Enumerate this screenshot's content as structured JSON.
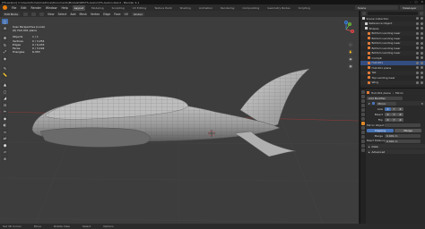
{
  "window": {
    "title": "[TS-Avalon] C:\\Users\\Home\\OneDrive\\Documents\\Models\\WIP\\TS-Avalon\\TS-Avalon.blend - Blender 4.1",
    "min": "–",
    "max": "□",
    "close": "✕"
  },
  "menubar": {
    "menus": [
      "File",
      "Edit",
      "Render",
      "Window",
      "Help"
    ],
    "tabs": [
      "Layout",
      "Modeling",
      "Sculpting",
      "UV Editing",
      "Texture Paint",
      "Shading",
      "Animation",
      "Rendering",
      "Compositing",
      "Geometry Nodes",
      "Scripting"
    ],
    "active_tab": "Layout",
    "scene": "Scene",
    "view_layer": "ViewLayer"
  },
  "header3d": {
    "mode": "Edit Mode",
    "items": [
      "View",
      "Select",
      "Add",
      "Mesh",
      "Vertex",
      "Edge",
      "Face",
      "UV"
    ],
    "orientation": "Global"
  },
  "viewport": {
    "overlay_title": "User Perspective (Local)",
    "overlay_object": "(0) Hull.001 plane",
    "stats": [
      {
        "label": "Objects",
        "value": "1 / 1"
      },
      {
        "label": "Vertices",
        "value": "0 / 3,254"
      },
      {
        "label": "Edges",
        "value": "0 / 6,433"
      },
      {
        "label": "Faces",
        "value": "0 / 3,194"
      },
      {
        "label": "Triangles",
        "value": "6,353"
      }
    ],
    "gizmo": {
      "x": "X",
      "y": "Y",
      "z": "Z"
    }
  },
  "outliner": {
    "rows": [
      {
        "label": "Scene Collection",
        "color": "#cfcfcf",
        "indent": 0,
        "selected": false
      },
      {
        "label": "Reference Object",
        "color": "#cfcfcf",
        "indent": 1,
        "selected": false
      },
      {
        "label": "Shapes",
        "color": "#cfcfcf",
        "indent": 1,
        "selected": false
      },
      {
        "label": "Bottom Landing Gear",
        "color": "#e07b39",
        "indent": 2,
        "selected": false
      },
      {
        "label": "Bottom Landing Gear",
        "color": "#e07b39",
        "indent": 2,
        "selected": false
      },
      {
        "label": "Bottom Landing Gear",
        "color": "#e07b39",
        "indent": 2,
        "selected": false
      },
      {
        "label": "Bottom Landing Gear",
        "color": "#e07b39",
        "indent": 2,
        "selected": false
      },
      {
        "label": "Bottom Landing Gear",
        "color": "#e07b39",
        "indent": 2,
        "selected": false
      },
      {
        "label": "Cockpit",
        "color": "#e07b39",
        "indent": 2,
        "selected": false
      },
      {
        "label": "Hull.001",
        "color": "#e07b39",
        "indent": 2,
        "selected": true
      },
      {
        "label": "Hull.001 plane",
        "color": "#e07b39",
        "indent": 2,
        "selected": false
      },
      {
        "label": "Tail",
        "color": "#e07b39",
        "indent": 2,
        "selected": false
      },
      {
        "label": "Top Landing Gear",
        "color": "#e07b39",
        "indent": 2,
        "selected": false
      },
      {
        "label": "Wing",
        "color": "#e07b39",
        "indent": 2,
        "selected": false
      }
    ]
  },
  "properties": {
    "object_name": "Hull.001 plane",
    "modifier_tab": "Mirror",
    "add_modifier": "Add Modifier",
    "modifier_name": "Mirror",
    "axis_label": "Axis",
    "axes": [
      "X",
      "Y",
      "Z"
    ],
    "bisect_label": "Bisect",
    "flip_label": "Flip",
    "mirror_object_label": "Mirror Object",
    "clipping": "Clipping",
    "merge": "Merge",
    "merge_value": "0.001 m",
    "bisect_distance": "Bisect Distance",
    "bisect_value": "0.001 m",
    "data_label": "Data",
    "advanced_label": "Advanced"
  },
  "statusbar": {
    "items": [
      "Set 3D Cursor",
      "Move",
      "Rotate View",
      "Select",
      "Options"
    ]
  },
  "colors": {
    "accent": "#4772b3",
    "blender_orange": "#e87d0d"
  }
}
